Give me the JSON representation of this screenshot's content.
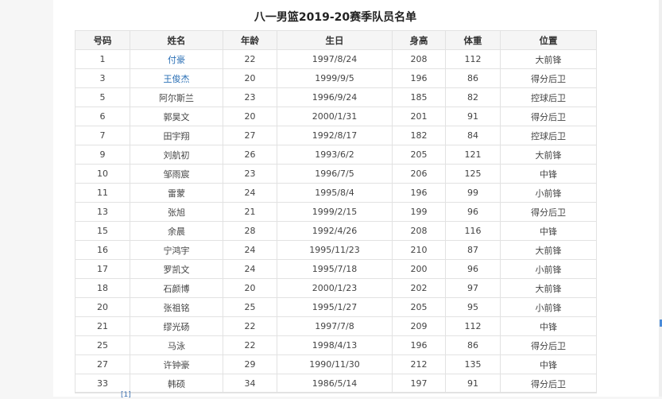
{
  "document": {
    "title": "八一男篮2019-20赛季队员名单",
    "footnote_ref": "[1]"
  },
  "table": {
    "headers": [
      "号码",
      "姓名",
      "年龄",
      "生日",
      "身高",
      "体重",
      "位置"
    ],
    "rows": [
      {
        "number": "1",
        "name": "付豪",
        "age": "22",
        "birthday": "1997/8/24",
        "height": "208",
        "weight": "112",
        "position": "大前锋",
        "link": true
      },
      {
        "number": "3",
        "name": "王俊杰",
        "age": "20",
        "birthday": "1999/9/5",
        "height": "196",
        "weight": "86",
        "position": "得分后卫",
        "link": true
      },
      {
        "number": "5",
        "name": "阿尔斯兰",
        "age": "23",
        "birthday": "1996/9/24",
        "height": "185",
        "weight": "82",
        "position": "控球后卫",
        "link": false
      },
      {
        "number": "6",
        "name": "郭昊文",
        "age": "20",
        "birthday": "2000/1/31",
        "height": "201",
        "weight": "91",
        "position": "得分后卫",
        "link": false
      },
      {
        "number": "7",
        "name": "田宇翔",
        "age": "27",
        "birthday": "1992/8/17",
        "height": "182",
        "weight": "84",
        "position": "控球后卫",
        "link": false
      },
      {
        "number": "9",
        "name": "刘航初",
        "age": "26",
        "birthday": "1993/6/2",
        "height": "205",
        "weight": "121",
        "position": "大前锋",
        "link": false
      },
      {
        "number": "10",
        "name": "邹雨宸",
        "age": "23",
        "birthday": "1996/7/5",
        "height": "206",
        "weight": "125",
        "position": "中锋",
        "link": false
      },
      {
        "number": "11",
        "name": "雷蒙",
        "age": "24",
        "birthday": "1995/8/4",
        "height": "196",
        "weight": "99",
        "position": "小前锋",
        "link": false
      },
      {
        "number": "13",
        "name": "张旭",
        "age": "21",
        "birthday": "1999/2/15",
        "height": "199",
        "weight": "96",
        "position": "得分后卫",
        "link": false
      },
      {
        "number": "15",
        "name": "余晨",
        "age": "28",
        "birthday": "1992/4/26",
        "height": "208",
        "weight": "116",
        "position": "中锋",
        "link": false
      },
      {
        "number": "16",
        "name": "宁鸿宇",
        "age": "24",
        "birthday": "1995/11/23",
        "height": "210",
        "weight": "87",
        "position": "大前锋",
        "link": false
      },
      {
        "number": "17",
        "name": "罗凯文",
        "age": "24",
        "birthday": "1995/7/18",
        "height": "200",
        "weight": "96",
        "position": "小前锋",
        "link": false
      },
      {
        "number": "18",
        "name": "石颜博",
        "age": "20",
        "birthday": "2000/1/23",
        "height": "202",
        "weight": "97",
        "position": "大前锋",
        "link": false
      },
      {
        "number": "20",
        "name": "张祖铭",
        "age": "25",
        "birthday": "1995/1/27",
        "height": "205",
        "weight": "95",
        "position": "小前锋",
        "link": false
      },
      {
        "number": "21",
        "name": "缪光砀",
        "age": "22",
        "birthday": "1997/7/8",
        "height": "209",
        "weight": "112",
        "position": "中锋",
        "link": false
      },
      {
        "number": "25",
        "name": "马泳",
        "age": "22",
        "birthday": "1998/4/13",
        "height": "196",
        "weight": "86",
        "position": "得分后卫",
        "link": false
      },
      {
        "number": "27",
        "name": "许钟豪",
        "age": "29",
        "birthday": "1990/11/30",
        "height": "212",
        "weight": "135",
        "position": "中锋",
        "link": false
      },
      {
        "number": "33",
        "name": "韩硕",
        "age": "34",
        "birthday": "1986/5/14",
        "height": "197",
        "weight": "91",
        "position": "得分后卫",
        "link": false
      }
    ]
  },
  "colors": {
    "link": "#2a6fb5",
    "border": "#e2e2e2",
    "header_bg": "#f5f5f5",
    "rail_accent": "#4a8bd8"
  }
}
